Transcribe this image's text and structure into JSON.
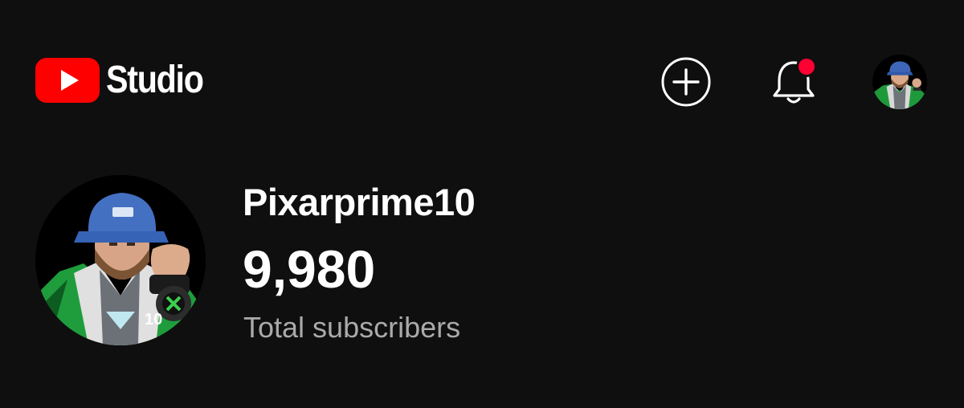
{
  "app": {
    "brand_text": "Studio",
    "brand_color": "#ff0000"
  },
  "header": {
    "create_icon": "plus-circle-icon",
    "notifications_icon": "bell-icon",
    "notification_dot_color": "#ff0033"
  },
  "channel": {
    "name": "Pixarprime10",
    "subscriber_count": "9,980",
    "subscriber_label": "Total subscribers"
  },
  "colors": {
    "background": "#0f0f0f",
    "primary_text": "#ffffff",
    "secondary_text": "#aaaaaa"
  }
}
